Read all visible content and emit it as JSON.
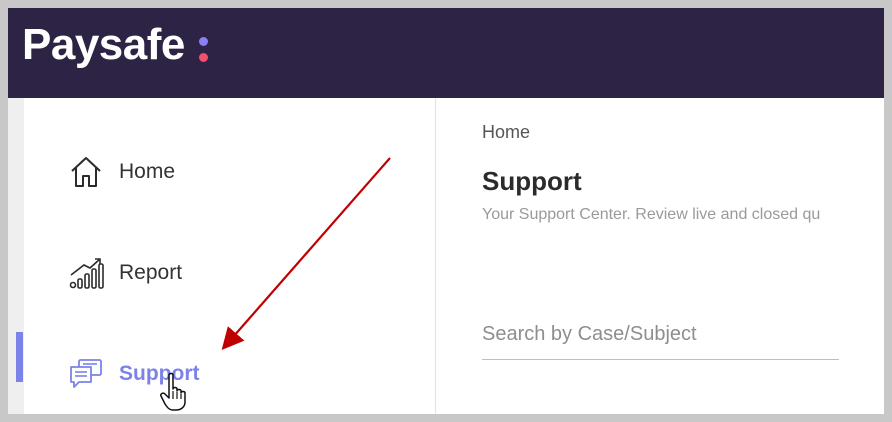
{
  "brand": {
    "name": "Paysafe",
    "dot_color_top": "#8b7ff5",
    "dot_color_bottom": "#f0506e",
    "topbar_color": "#2d2344"
  },
  "sidebar": {
    "items": [
      {
        "label": "Home",
        "icon": "home-icon",
        "active": false
      },
      {
        "label": "Report",
        "icon": "report-chart-icon",
        "active": false
      },
      {
        "label": "Support",
        "icon": "support-chat-icon",
        "active": true
      }
    ],
    "accent_color": "#7b83e8"
  },
  "main": {
    "breadcrumb": "Home",
    "title": "Support",
    "subtitle": "Your Support Center. Review live and closed qu",
    "search": {
      "placeholder": "Search by Case/Subject",
      "value": ""
    }
  },
  "annotation": {
    "arrow_color": "#c00000",
    "cursor": "hand-pointer-icon"
  }
}
